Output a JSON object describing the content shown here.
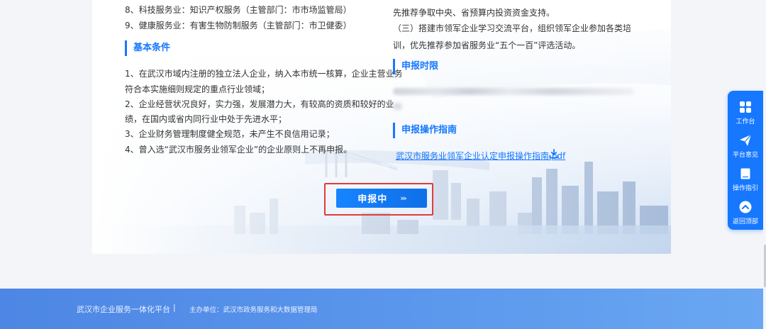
{
  "left_column": {
    "industry_items": [
      "8、科技服务业：知识产权服务（主管部门：市市场监管局）",
      "9、健康服务业：有害生物防制服务（主管部门：市卫健委）"
    ],
    "conditions_title": "基本条件",
    "conditions": [
      "1、在武汉市域内注册的独立法人企业，纳入本市统一核算，企业主营业务",
      "符合本实施细则规定的重点行业领域；",
      "2、企业经营状况良好，实力强，发展潜力大，有较高的资质和较好的业",
      "绩，在国内或省内同行业中处于先进水平；",
      "3、企业财务管理制度健全规范，未产生不良信用记录；",
      "4、曾入选“武汉市服务业领军企业”的企业原则上不再申报。"
    ]
  },
  "right_column": {
    "policy_tail": "先推荐争取中央、省预算内投资资金支持。",
    "policy_three": "（三）搭建市领军企业学习交流平台，组织领军企业参加各类培训，优先推荐参加省服务业“五个一百”评选活动。",
    "deadline_title": "申报时限",
    "guide_title": "申报操作指南",
    "guide_file": "武汉市服务业领军企业认定申报操作指南.pdf",
    "download_icon": "download-icon"
  },
  "apply_button": {
    "label": "申报中",
    "arrows": "›››"
  },
  "sidebar": {
    "items": [
      {
        "label": "工作台",
        "icon": "grid-icon"
      },
      {
        "label": "平台意见",
        "icon": "paper-plane-icon"
      },
      {
        "label": "操作指引",
        "icon": "book-icon"
      },
      {
        "label": "返回顶部",
        "icon": "chevron-up-circle-icon"
      }
    ]
  },
  "footer": {
    "brand": "武汉市企业服务一体化平台",
    "separator": "|",
    "host": "主办单位：武汉市政务服务和大数据管理局"
  },
  "colors": {
    "accent": "#1677ff",
    "highlight_box": "#e23b3b",
    "footer": "#5b97ec"
  }
}
